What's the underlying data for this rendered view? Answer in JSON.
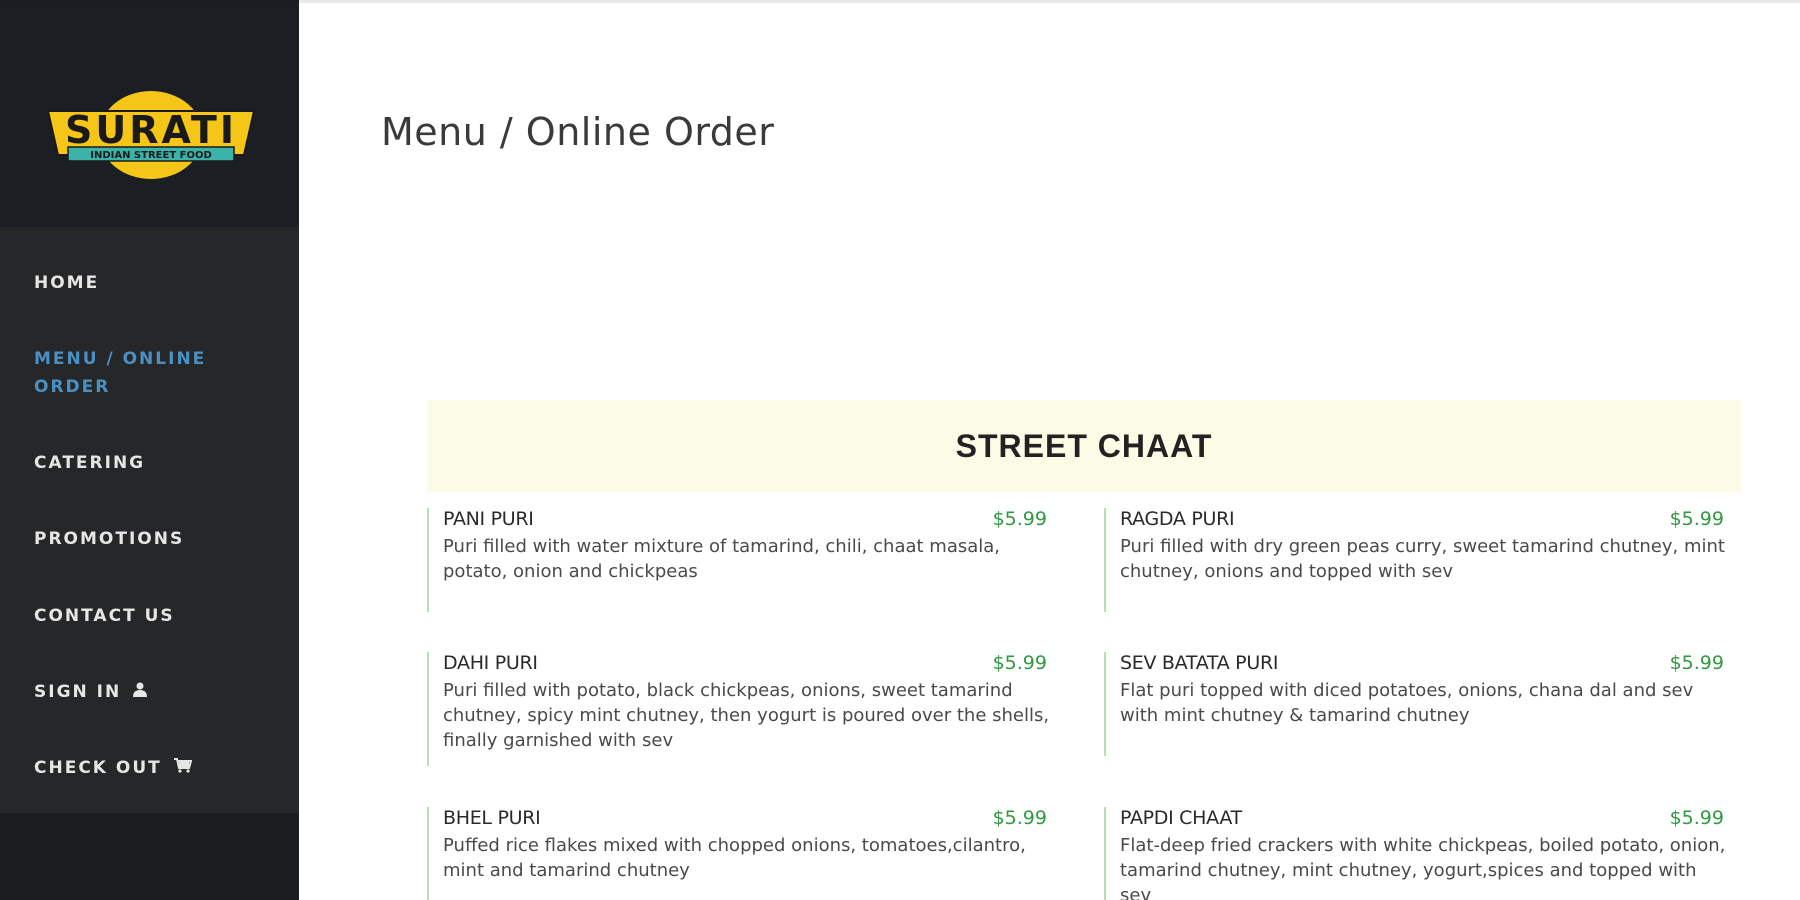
{
  "brand": {
    "name": "SURATI",
    "tagline": "INDIAN STREET FOOD",
    "colors": {
      "yellow": "#f5c518",
      "teal": "#3bb3a8",
      "text": "#1a1a1a"
    }
  },
  "nav": {
    "items": [
      {
        "label": "HOME",
        "icon": ""
      },
      {
        "label": "MENU / ONLINE ORDER",
        "icon": "",
        "active": true
      },
      {
        "label": "CATERING",
        "icon": ""
      },
      {
        "label": "PROMOTIONS",
        "icon": ""
      },
      {
        "label": "CONTACT US",
        "icon": ""
      },
      {
        "label": "SIGN IN",
        "icon": "user-icon"
      },
      {
        "label": "CHECK OUT",
        "icon": "cart-icon"
      }
    ]
  },
  "page": {
    "title": "Menu / Online Order"
  },
  "section": {
    "title": "STREET CHAAT",
    "items": [
      {
        "name": "PANI PURI",
        "price": "$5.99",
        "description": "Puri filled with water mixture of tamarind, chili, chaat masala, potato, onion and chickpeas"
      },
      {
        "name": "RAGDA PURI",
        "price": "$5.99",
        "description": "Puri filled with dry green peas curry, sweet tamarind chutney, mint chutney, onions and topped with sev"
      },
      {
        "name": "DAHI PURI",
        "price": "$5.99",
        "description": "Puri filled with potato, black chickpeas, onions, sweet tamarind chutney, spicy mint chutney, then yogurt is poured over the shells, finally garnished with sev"
      },
      {
        "name": "SEV BATATA PURI",
        "price": "$5.99",
        "description": "Flat puri topped with diced potatoes, onions, chana dal and sev with mint chutney & tamarind chutney"
      },
      {
        "name": "BHEL PURI",
        "price": "$5.99",
        "description": "Puffed rice flakes mixed with chopped onions, tomatoes,cilantro, mint and tamarind chutney"
      },
      {
        "name": "PAPDI CHAAT",
        "price": "$5.99",
        "description": "Flat-deep fried crackers with white chickpeas, boiled potato, onion, tamarind chutney, mint chutney, yogurt,spices and topped with sev"
      }
    ]
  }
}
